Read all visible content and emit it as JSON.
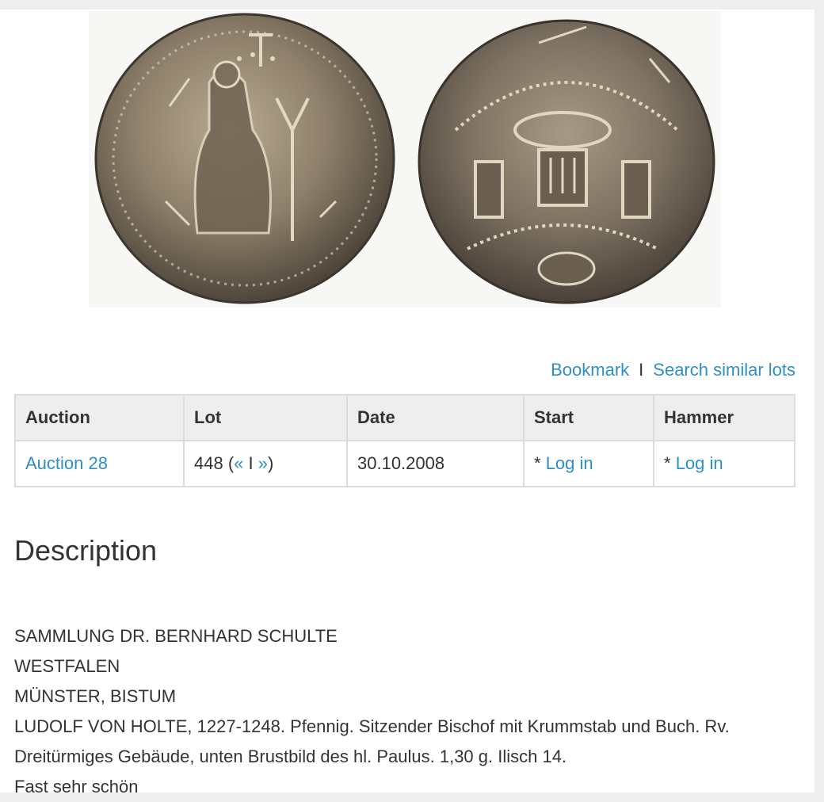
{
  "images": {
    "obverse": "coin-obverse-image",
    "reverse": "coin-reverse-image"
  },
  "actions": {
    "bookmark": "Bookmark",
    "separator": "I",
    "search_similar": "Search similar lots"
  },
  "table": {
    "headers": [
      "Auction",
      "Lot",
      "Date",
      "Start",
      "Hammer"
    ],
    "row": {
      "auction": "Auction 28",
      "lot_number": "448",
      "lot_open": "(",
      "prev": "«",
      "lot_sep": "I",
      "next": "»",
      "lot_close": ")",
      "date": "30.10.2008",
      "start_prefix": "*",
      "start_link": "Log in",
      "hammer_prefix": "*",
      "hammer_link": "Log in"
    }
  },
  "description": {
    "title": "Description",
    "lines": [
      "SAMMLUNG DR. BERNHARD SCHULTE",
      "WESTFALEN",
      "MÜNSTER, BISTUM",
      "LUDOLF VON HOLTE, 1227-1248. Pfennig. Sitzender Bischof mit Krummstab und Buch. Rv.",
      "Dreitürmiges Gebäude, unten Brustbild des hl. Paulus. 1,30 g. Ilisch 14.",
      "Fast sehr schön"
    ]
  },
  "colors": {
    "link": "#2e8fc6",
    "text": "#333333",
    "header_bg": "#eeeeee",
    "border": "#dcdcdc"
  }
}
